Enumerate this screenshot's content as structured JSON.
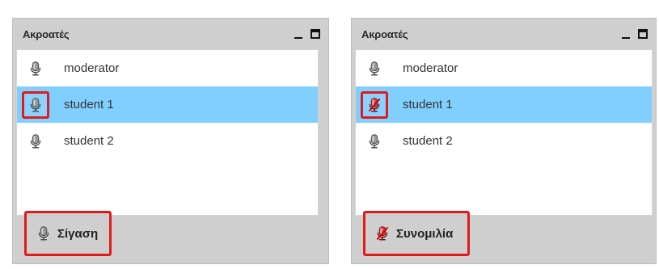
{
  "panels": [
    {
      "title": "Ακροατές",
      "users": [
        {
          "name": "moderator",
          "icon": "microphone-icon",
          "selected": false,
          "highlighted": false
        },
        {
          "name": "student 1",
          "icon": "microphone-icon",
          "selected": true,
          "highlighted": true
        },
        {
          "name": "student 2",
          "icon": "microphone-icon",
          "selected": false,
          "highlighted": false
        }
      ],
      "action": {
        "label": "Σίγαση",
        "icon": "microphone-icon"
      }
    },
    {
      "title": "Ακροατές",
      "users": [
        {
          "name": "moderator",
          "icon": "microphone-icon",
          "selected": false,
          "highlighted": false
        },
        {
          "name": "student 1",
          "icon": "microphone-muted-icon",
          "selected": true,
          "highlighted": true
        },
        {
          "name": "student 2",
          "icon": "microphone-icon",
          "selected": false,
          "highlighted": false
        }
      ],
      "action": {
        "label": "Συνομιλία",
        "icon": "microphone-muted-icon"
      }
    }
  ],
  "colors": {
    "selected_row": "#81cfff",
    "highlight_border": "#e11b1b",
    "panel_bg": "#cfcfcf"
  }
}
